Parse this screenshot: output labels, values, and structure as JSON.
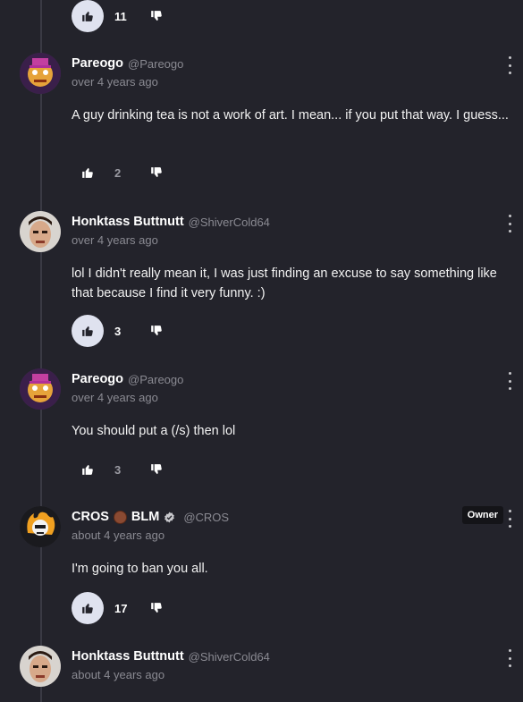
{
  "top": {
    "likes": "11"
  },
  "comments": [
    {
      "author": "Pareogo",
      "handle": "@Pareogo",
      "time": "over 4 years ago",
      "text": "A guy drinking tea is not a work of art. I mean... if you put that way. I guess...",
      "likes": "2",
      "liked": false
    },
    {
      "author": "Honktass Buttnutt",
      "handle": "@ShiverCold64",
      "time": "over 4 years ago",
      "text": "lol I didn't really mean it, I was just finding an excuse to say something like that because I find it very funny. :)",
      "likes": "3",
      "liked": true
    },
    {
      "author": "Pareogo",
      "handle": "@Pareogo",
      "time": "over 4 years ago",
      "text": "You should put a (/s) then lol",
      "likes": "3",
      "liked": false
    },
    {
      "author_part1": "CROS",
      "author_part2": "BLM",
      "handle": "@CROS",
      "time": "about 4 years ago",
      "badge": "Owner",
      "text": "I'm going to ban you all.",
      "likes": "17",
      "liked": true
    },
    {
      "author": "Honktass Buttnutt",
      "handle": "@ShiverCold64",
      "time": "about 4 years ago"
    }
  ],
  "icons": {
    "like": "thumbs-up-icon",
    "dislike": "thumbs-down-icon",
    "more": "more-vertical-icon",
    "verified": "verified-badge-icon",
    "fist": "raised-fist-emoji"
  },
  "colors": {
    "background": "#23232b",
    "liked_pill": "#dfe2ef",
    "owner_badge": "#141418"
  }
}
